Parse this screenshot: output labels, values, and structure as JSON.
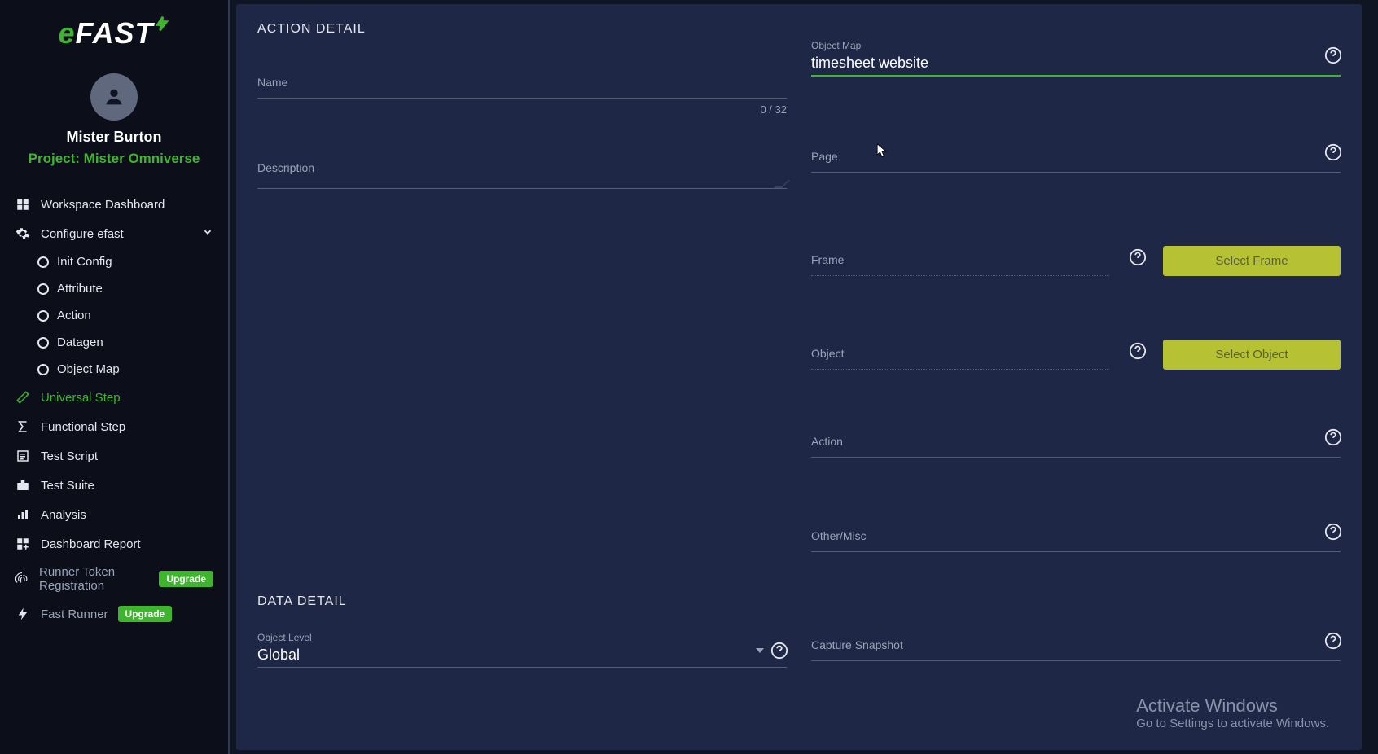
{
  "app": {
    "logo_prefix": "e",
    "logo_text": "FAST"
  },
  "user": {
    "name": "Mister Burton",
    "project": "Project: Mister Omniverse"
  },
  "sidebar": {
    "workspace": "Workspace Dashboard",
    "configure": "Configure efast",
    "items": {
      "init_config": "Init Config",
      "attribute": "Attribute",
      "action": "Action",
      "datagen": "Datagen",
      "object_map": "Object Map"
    },
    "universal_step": "Universal Step",
    "functional_step": "Functional Step",
    "test_script": "Test Script",
    "test_suite": "Test Suite",
    "analysis": "Analysis",
    "dashboard_report": "Dashboard Report",
    "runner_token": "Runner Token Registration",
    "fast_runner": "Fast Runner",
    "upgrade": "Upgrade"
  },
  "main": {
    "action_detail": "ACTION DETAIL",
    "data_detail": "DATA DETAIL",
    "labels": {
      "name": "Name",
      "description": "Description",
      "object_map": "Object Map",
      "page": "Page",
      "frame": "Frame",
      "object": "Object",
      "action": "Action",
      "other_misc": "Other/Misc",
      "object_level": "Object Level",
      "capture_snapshot": "Capture Snapshot"
    },
    "values": {
      "name": "",
      "object_map": "timesheet website",
      "object_level": "Global"
    },
    "counter": "0 / 32",
    "buttons": {
      "select_frame": "Select Frame",
      "select_object": "Select Object"
    }
  },
  "windows": {
    "title": "Activate Windows",
    "sub": "Go to Settings to activate Windows."
  }
}
